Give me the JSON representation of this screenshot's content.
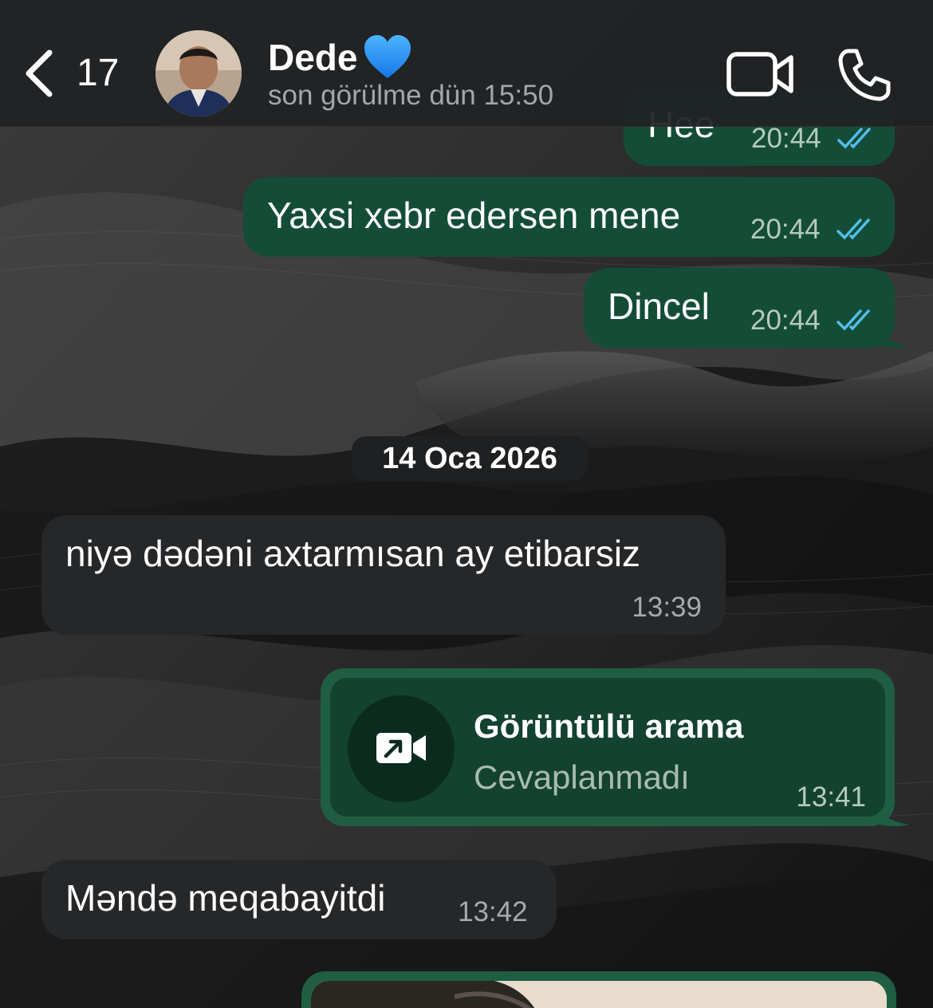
{
  "header": {
    "back_count": "17",
    "contact_name": "Dede",
    "last_seen": "son görülme dün 15:50",
    "icons": [
      "chevron-left-icon",
      "blue-heart-icon",
      "video-call-icon",
      "phone-icon"
    ]
  },
  "messages": [
    {
      "direction": "outgoing",
      "text": "Hee",
      "time": "20:44",
      "status": "read"
    },
    {
      "direction": "outgoing",
      "text": "Yaxsi xebr edersen mene",
      "time": "20:44",
      "status": "read"
    },
    {
      "direction": "outgoing",
      "text": "Dincel",
      "time": "20:44",
      "status": "read"
    }
  ],
  "date_separator": "14 Oca 2026",
  "messages2": [
    {
      "direction": "incoming",
      "text": "niyə dədəni axtarmısan ay etibarsiz",
      "time": "13:39"
    }
  ],
  "call": {
    "title": "Görüntülü arama",
    "status": "Cevaplanmadı",
    "time": "13:41",
    "icon": "outgoing-video-call-icon"
  },
  "messages3": [
    {
      "direction": "incoming",
      "text": "Məndə meqabayitdi",
      "time": "13:42"
    }
  ],
  "colors": {
    "outgoing_bubble": "#144d37",
    "incoming_bubble": "#262729",
    "read_ticks": "#53bdeb",
    "header_bg": "#202224"
  }
}
